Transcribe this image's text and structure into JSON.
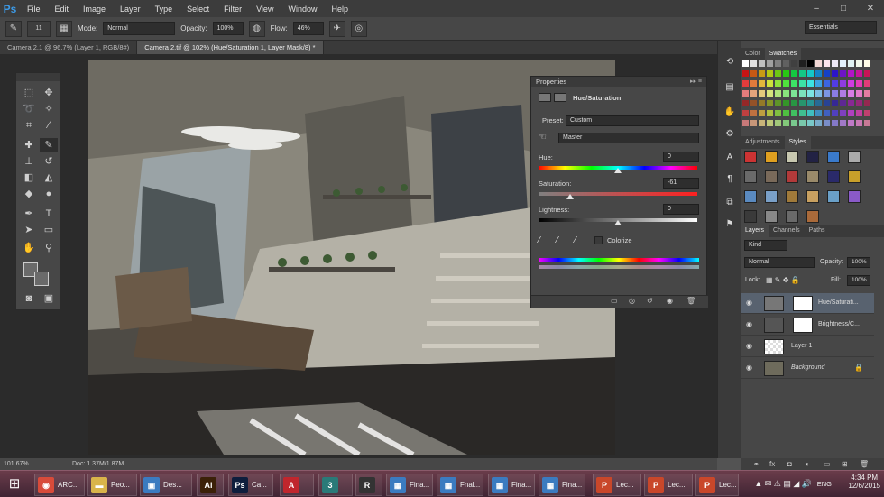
{
  "app": {
    "logo": "Ps",
    "menus": [
      "File",
      "Edit",
      "Image",
      "Layer",
      "Type",
      "Select",
      "Filter",
      "View",
      "Window",
      "Help"
    ]
  },
  "options": {
    "brush_size": "11",
    "mode_label": "Mode:",
    "mode_value": "Normal",
    "opacity_label": "Opacity:",
    "opacity_value": "100%",
    "flow_label": "Flow:",
    "flow_value": "46%",
    "workspace": "Essentials"
  },
  "tabs": [
    "Camera 2.1 @ 96.7% (Layer 1, RGB/8#)",
    "Camera 2.tif @ 102% (Hue/Saturation 1, Layer Mask/8) *"
  ],
  "status": {
    "zoom": "101.67%",
    "doc": "Doc: 1.37M/1.87M"
  },
  "properties": {
    "title": "Properties",
    "adjustment": "Hue/Saturation",
    "preset_label": "Preset:",
    "preset_value": "Custom",
    "channel_value": "Master",
    "hue_label": "Hue:",
    "hue_value": "0",
    "saturation_label": "Saturation:",
    "saturation_value": "-61",
    "lightness_label": "Lightness:",
    "lightness_value": "0",
    "colorize_label": "Colorize"
  },
  "right_panel": {
    "top_tabs": [
      "Color",
      "Swatches"
    ],
    "adj_tabs": [
      "Adjustments",
      "Styles"
    ],
    "layer_tabs": [
      "Layers",
      "Channels",
      "Paths"
    ],
    "kind_label": "Kind",
    "blend_mode": "Normal",
    "opacity_label": "Opacity:",
    "opacity_value": "100%",
    "lock_label": "Lock:",
    "fill_label": "Fill:",
    "fill_value": "100%",
    "layers": [
      {
        "name": "Hue/Saturati..."
      },
      {
        "name": "Brightness/C..."
      },
      {
        "name": "Layer 1"
      },
      {
        "name": "Background"
      }
    ]
  },
  "taskbar": {
    "items": [
      {
        "label": "ARC...",
        "icon": "chrome-icon",
        "color": "#d84b3a"
      },
      {
        "label": "Peo...",
        "icon": "folder-icon",
        "color": "#d9b44a"
      },
      {
        "label": "Des...",
        "icon": "desktop-icon",
        "color": "#3b7bc0"
      },
      {
        "label": "",
        "icon": "illustrator-icon",
        "color": "#3b2108"
      },
      {
        "label": "Ca...",
        "icon": "photoshop-icon",
        "color": "#0e1e3d"
      },
      {
        "label": "",
        "icon": "autocad-icon",
        "color": "#c0262d"
      },
      {
        "label": "",
        "icon": "3dsmax-icon",
        "color": "#2a7a78"
      },
      {
        "label": "",
        "icon": "rhino-icon",
        "color": "#333333"
      },
      {
        "label": "Fina...",
        "icon": "photo-viewer-icon",
        "color": "#3b7bc0"
      },
      {
        "label": "Fnal...",
        "icon": "photo-viewer-icon",
        "color": "#3b7bc0"
      },
      {
        "label": "Fina...",
        "icon": "photo-viewer-icon",
        "color": "#3b7bc0"
      },
      {
        "label": "Fina...",
        "icon": "photo-viewer-icon",
        "color": "#3b7bc0"
      },
      {
        "label": "Lec...",
        "icon": "powerpoint-icon",
        "color": "#c9472a"
      },
      {
        "label": "Lec...",
        "icon": "powerpoint-icon",
        "color": "#c9472a"
      },
      {
        "label": "Lec...",
        "icon": "powerpoint-icon",
        "color": "#c9472a"
      }
    ],
    "language": "ENG",
    "time": "4:34 PM",
    "date": "12/6/2015"
  }
}
